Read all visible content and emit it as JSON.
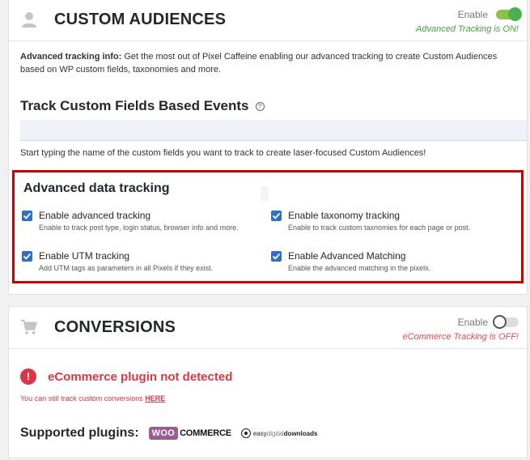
{
  "audiences": {
    "title": "CUSTOM AUDIENCES",
    "enable_label": "Enable",
    "toggle_on": true,
    "status_text": "Advanced Tracking is ON!",
    "info_bold": "Advanced tracking info:",
    "info_text": " Get the most out of Pixel Caffeine enabling our advanced tracking to create Custom Audiences based on WP custom fields, taxonomies and more.",
    "section_title": "Track Custom Fields Based Events",
    "help_glyph": "?",
    "fields_input_value": "",
    "hint": "Start typing the name of the custom fields you want to track to create laser-focused Custom Audiences!",
    "advanced": {
      "title": "Advanced data tracking",
      "items": [
        {
          "label": "Enable advanced tracking",
          "desc": "Enable to track post type, login status, browser info and more.",
          "checked": true
        },
        {
          "label": "Enable taxonomy tracking",
          "desc": "Enable to track custom taxnomies for each page or post.",
          "checked": true
        },
        {
          "label": "Enable UTM tracking",
          "desc": "Add UTM tags as parameters in all Pixels if they exist.",
          "checked": true
        },
        {
          "label": "Enable Advanced Matching",
          "desc": "Enable the advanced matching in the pixels.",
          "checked": true
        }
      ]
    }
  },
  "conversions": {
    "title": "CONVERSIONS",
    "enable_label": "Enable",
    "toggle_on": false,
    "status_text": "eCommerce Tracking is OFF!",
    "error_glyph": "!",
    "error_title": "eCommerce plugin not detected",
    "track_note": "You can still track custom conversions ",
    "track_link": "HERE",
    "plugins_label": "Supported plugins:",
    "woo_badge": "WOO",
    "woo_text": "COMMERCE",
    "edd_light": "easy",
    "edd_mid": "digital",
    "edd_bold": "downloads"
  },
  "colors": {
    "accent_blue": "#2f6fc7",
    "error_red": "#dc3545",
    "toggle_green": "#4caf50",
    "highlight_border": "#cc0000"
  },
  "icons": {
    "audiences": "user-icon",
    "conversions": "cart-icon",
    "checkbox": "checkmark-icon"
  }
}
